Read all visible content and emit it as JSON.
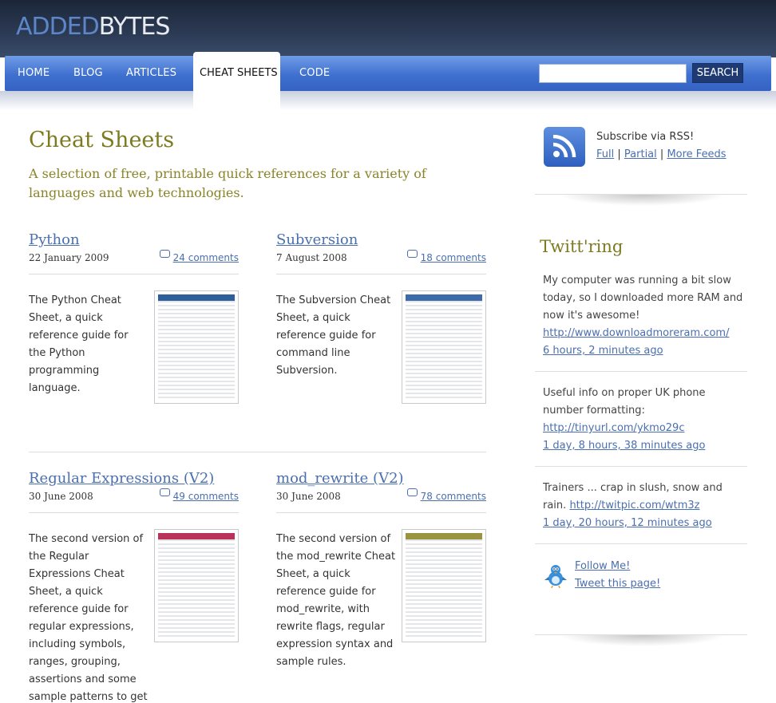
{
  "header": {
    "logo_part1": "ADDED",
    "logo_part2": "BYTES",
    "nav": [
      "HOME",
      "BLOG",
      "ARTICLES",
      "CHEAT SHEETS",
      "CODE"
    ],
    "search_value": "",
    "search_button": "SEARCH"
  },
  "main": {
    "title": "Cheat Sheets",
    "intro": "A selection of free, printable quick references for a variety of languages and web technologies.",
    "sheets": [
      {
        "title": "Python",
        "date": "22 January 2009",
        "comments": "24 comments",
        "description": "The Python Cheat Sheet, a quick reference guide for the Python programming language.",
        "thumb_color": "#2f5f9a"
      },
      {
        "title": "Subversion",
        "date": "7 August 2008",
        "comments": "18 comments",
        "description": "The Subversion Cheat Sheet, a quick reference guide for command line Subversion.",
        "thumb_color": "#3d6aa8"
      },
      {
        "title": "Regular Expressions (V2)",
        "date": "30 June 2008",
        "comments": "49 comments",
        "description": "The second version of the Regular Expressions Cheat Sheet, a quick reference guide for regular expressions, including symbols, ranges, grouping, assertions and some sample patterns to get you started.",
        "thumb_color": "#b8325a"
      },
      {
        "title": "mod_rewrite (V2)",
        "date": "30 June 2008",
        "comments": "78 comments",
        "description": "The second version of the mod_rewrite Cheat Sheet, a quick reference guide for mod_rewrite, with rewrite flags, regular expression syntax and sample rules.",
        "thumb_color": "#9a9440"
      }
    ]
  },
  "sidebar": {
    "rss_text": "Subscribe via RSS!",
    "rss_links": [
      "Full",
      "Partial",
      "More Feeds"
    ],
    "rss_separator": "|",
    "twitter_title": "Twitt'ring",
    "tweets": [
      {
        "text": "My computer was running a bit slow today, so I downloaded more RAM and now it's awesome!",
        "link": "http://www.downloadmoreram.com/",
        "time": "6 hours, 2 minutes ago"
      },
      {
        "text": "Useful info on proper UK phone number formatting:",
        "link": "http://tinyurl.com/ykmo29c",
        "time": "1 day, 8 hours, 38 minutes ago"
      },
      {
        "text": "Trainers ... crap in slush, snow and rain.",
        "link": "http://twitpic.com/wtm3z",
        "time": "1 day, 20 hours, 12 minutes ago"
      }
    ],
    "follow_label": "Follow Me!",
    "tweet_page_label": "Tweet this page!"
  }
}
